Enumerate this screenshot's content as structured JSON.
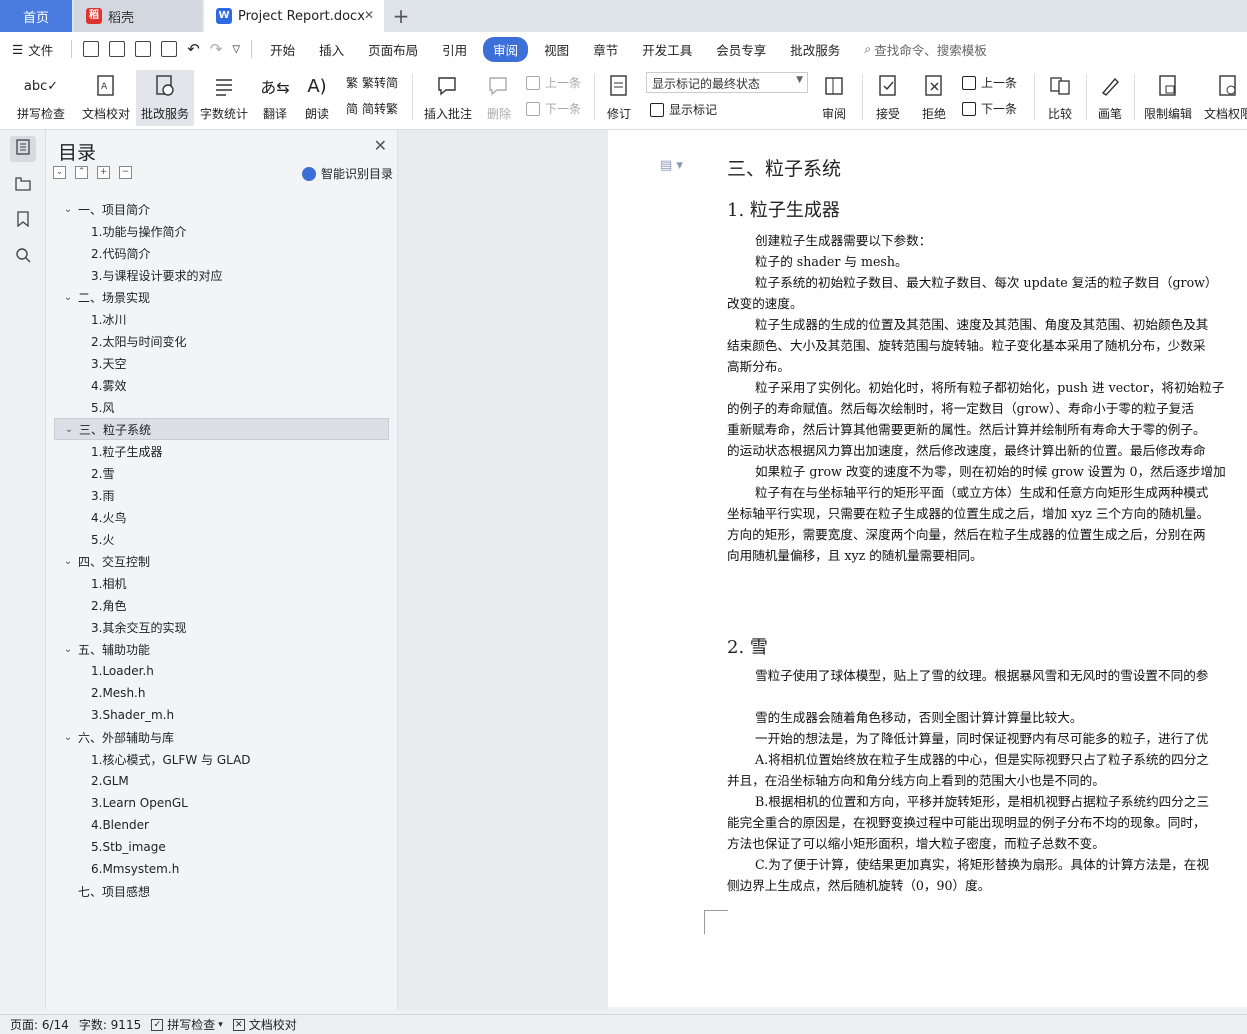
{
  "tabs": {
    "home": "首页",
    "daoke": "稻壳",
    "doc": "Project Report.docx"
  },
  "menu": {
    "file": "文件",
    "items": [
      "开始",
      "插入",
      "页面布局",
      "引用",
      "审阅",
      "视图",
      "章节",
      "开发工具",
      "会员专享",
      "批改服务"
    ],
    "search": "查找命令、搜索模板"
  },
  "ribbon": {
    "spell": "拼写检查",
    "proof": "文档校对",
    "review_service": "批改服务",
    "wordcount": "字数统计",
    "translate": "翻译",
    "read": "朗读",
    "trad": "繁转简",
    "simp": "简转繁",
    "insert_comment": "插入批注",
    "delete": "删除",
    "prev": "上一条",
    "next": "下一条",
    "revise": "修订",
    "display_state": "显示标记的最终状态",
    "show_marks": "显示标记",
    "review": "审阅",
    "accept": "接受",
    "reject": "拒绝",
    "prev2": "上一条",
    "next2": "下一条",
    "compare": "比较",
    "pen": "画笔",
    "restrict": "限制编辑",
    "doc_perm": "文档权限"
  },
  "toc": {
    "title": "目录",
    "smart": "智能识别目录",
    "items": [
      {
        "level": 1,
        "text": "一、项目简介"
      },
      {
        "level": 2,
        "text": "1.功能与操作简介"
      },
      {
        "level": 2,
        "text": "2.代码简介"
      },
      {
        "level": 2,
        "text": "3.与课程设计要求的对应"
      },
      {
        "level": 1,
        "text": "二、场景实现"
      },
      {
        "level": 2,
        "text": "1.冰川"
      },
      {
        "level": 2,
        "text": "2.太阳与时间变化"
      },
      {
        "level": 2,
        "text": "3.天空"
      },
      {
        "level": 2,
        "text": "4.雾效"
      },
      {
        "level": 2,
        "text": "5.风"
      },
      {
        "level": 1,
        "text": "三、粒子系统"
      },
      {
        "level": 2,
        "text": "1.粒子生成器"
      },
      {
        "level": 2,
        "text": "2.雪"
      },
      {
        "level": 2,
        "text": "3.雨"
      },
      {
        "level": 2,
        "text": "4.火鸟"
      },
      {
        "level": 2,
        "text": "5.火"
      },
      {
        "level": 1,
        "text": "四、交互控制"
      },
      {
        "level": 2,
        "text": "1.相机"
      },
      {
        "level": 2,
        "text": "2.角色"
      },
      {
        "level": 2,
        "text": "3.其余交互的实现"
      },
      {
        "level": 1,
        "text": "五、辅助功能"
      },
      {
        "level": 2,
        "text": "1.Loader.h"
      },
      {
        "level": 2,
        "text": "2.Mesh.h"
      },
      {
        "level": 2,
        "text": "3.Shader_m.h"
      },
      {
        "level": 1,
        "text": "六、外部辅助与库"
      },
      {
        "level": 2,
        "text": "1.核心模式，GLFW 与 GLAD"
      },
      {
        "level": 2,
        "text": "2.GLM"
      },
      {
        "level": 2,
        "text": "3.Learn OpenGL"
      },
      {
        "level": 2,
        "text": "4.Blender"
      },
      {
        "level": 2,
        "text": "5.Stb_image"
      },
      {
        "level": 2,
        "text": "6.Mmsystem.h"
      },
      {
        "level": 1,
        "text": "七、项目感想",
        "nochev": true
      }
    ]
  },
  "document": {
    "h1": "三、粒子系统",
    "sec1_title": "1. 粒子生成器",
    "sec1": [
      {
        "ind": true,
        "t": "创建粒子生成器需要以下参数："
      },
      {
        "ind": true,
        "t": "粒子的 shader 与 mesh。"
      },
      {
        "ind": true,
        "t": "粒子系统的初始粒子数目、最大粒子数目、每次 update 复活的粒子数目（grow）"
      },
      {
        "ind": false,
        "t": "改变的速度。"
      },
      {
        "ind": true,
        "t": "粒子生成器的生成的位置及其范围、速度及其范围、角度及其范围、初始颜色及其"
      },
      {
        "ind": false,
        "t": "结束颜色、大小及其范围、旋转范围与旋转轴。粒子变化基本采用了随机分布，少数采"
      },
      {
        "ind": false,
        "t": "高斯分布。"
      },
      {
        "ind": true,
        "t": "粒子采用了实例化。初始化时，将所有粒子都初始化，push 进 vector，将初始粒子"
      },
      {
        "ind": false,
        "t": "的例子的寿命赋值。然后每次绘制时，将一定数目（grow）、寿命小于零的粒子复活"
      },
      {
        "ind": false,
        "t": "重新赋寿命，然后计算其他需要更新的属性。然后计算并绘制所有寿命大于零的例子。"
      },
      {
        "ind": false,
        "t": "的运动状态根据风力算出加速度，然后修改速度，最终计算出新的位置。最后修改寿命"
      },
      {
        "ind": true,
        "t": "如果粒子 grow 改变的速度不为零，则在初始的时候 grow 设置为 0，然后逐步增加"
      },
      {
        "ind": true,
        "t": "粒子有在与坐标轴平行的矩形平面（或立方体）生成和任意方向矩形生成两种模式"
      },
      {
        "ind": false,
        "t": "坐标轴平行实现，只需要在粒子生成器的位置生成之后，增加 xyz 三个方向的随机量。"
      },
      {
        "ind": false,
        "t": "方向的矩形，需要宽度、深度两个向量，然后在粒子生成器的位置生成之后，分别在两"
      },
      {
        "ind": false,
        "t": "向用随机量偏移，且 xyz 的随机量需要相同。"
      }
    ],
    "sec2_title": "2. 雪",
    "sec2a": "雪粒子使用了球体模型，贴上了雪的纹理。根据暴风雪和无风时的雪设置不同的参",
    "sec2": [
      {
        "ind": true,
        "t": "雪的生成器会随着角色移动，否则全图计算计算量比较大。"
      },
      {
        "ind": true,
        "t": "一开始的想法是，为了降低计算量，同时保证视野内有尽可能多的粒子，进行了优"
      },
      {
        "ind": true,
        "t": "A.将相机位置始终放在粒子生成器的中心，但是实际视野只占了粒子系统的四分之"
      },
      {
        "ind": false,
        "t": "并且，在沿坐标轴方向和角分线方向上看到的范围大小也是不同的。"
      },
      {
        "ind": true,
        "t": "B.根据相机的位置和方向，平移并旋转矩形，是相机视野占据粒子系统约四分之三"
      },
      {
        "ind": false,
        "t": "能完全重合的原因是，在视野变换过程中可能出现明显的例子分布不均的现象。同时，"
      },
      {
        "ind": false,
        "t": "方法也保证了可以缩小矩形面积，增大粒子密度，而粒子总数不变。"
      },
      {
        "ind": true,
        "t": "C.为了便于计算，使结果更加真实，将矩形替换为扇形。具体的计算方法是，在视"
      },
      {
        "ind": false,
        "t": "侧边界上生成点，然后随机旋转（0，90）度。"
      }
    ]
  },
  "status": {
    "page": "页面: 6/14",
    "words": "字数: 9115",
    "spell": "拼写检查",
    "proof": "文档校对"
  }
}
